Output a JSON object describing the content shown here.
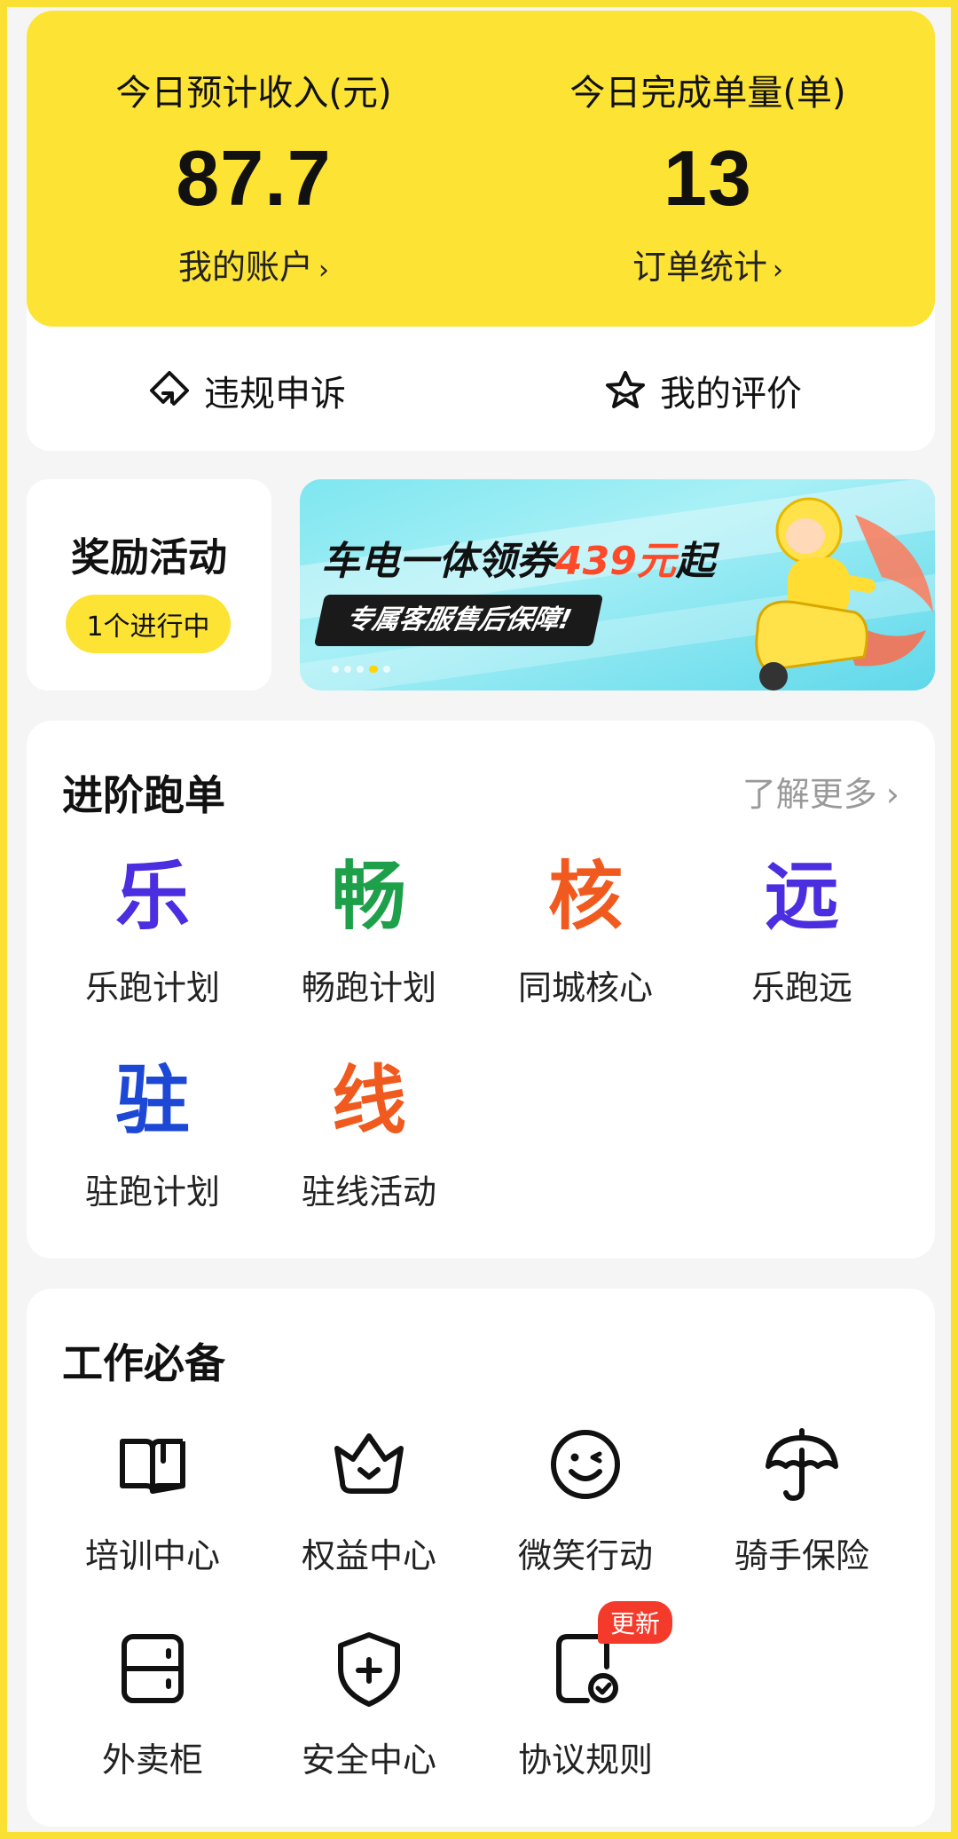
{
  "stats": {
    "income": {
      "label": "今日预计收入(元)",
      "value": "87.7",
      "link": "我的账户"
    },
    "orders": {
      "label": "今日完成单量(单)",
      "value": "13",
      "link": "订单统计"
    },
    "chevron": "›"
  },
  "actions": {
    "appeal": {
      "label": "违规申诉",
      "icon": "diamond-arrow-icon"
    },
    "evaluation": {
      "label": "我的评价",
      "icon": "star-icon"
    }
  },
  "reward": {
    "title": "奖励活动",
    "badge": "1个进行中"
  },
  "banner": {
    "title_prefix": "车电一体领券",
    "title_highlight": "439元",
    "title_suffix": "起",
    "subtitle": "专属客服售后保障!"
  },
  "advanced": {
    "title": "进阶跑单",
    "more": "了解更多",
    "chevron": "›",
    "items": [
      {
        "glyph": "乐",
        "label": "乐跑计划",
        "color": "#4b2ee0"
      },
      {
        "glyph": "畅",
        "label": "畅跑计划",
        "color": "#1ea04a"
      },
      {
        "glyph": "核",
        "label": "同城核心",
        "color": "#f05a1e"
      },
      {
        "glyph": "远",
        "label": "乐跑远",
        "color": "#4b2ee0"
      },
      {
        "glyph": "驻",
        "label": "驻跑计划",
        "color": "#1d48d6"
      },
      {
        "glyph": "线",
        "label": "驻线活动",
        "color": "#f05a1e"
      }
    ]
  },
  "work": {
    "title": "工作必备",
    "items": [
      {
        "label": "培训中心",
        "icon": "book-icon"
      },
      {
        "label": "权益中心",
        "icon": "crown-icon"
      },
      {
        "label": "微笑行动",
        "icon": "smile-icon"
      },
      {
        "label": "骑手保险",
        "icon": "umbrella-icon"
      },
      {
        "label": "外卖柜",
        "icon": "locker-icon"
      },
      {
        "label": "安全中心",
        "icon": "shield-icon"
      },
      {
        "label": "协议规则",
        "icon": "document-check-icon",
        "badge": "更新"
      }
    ]
  },
  "colors": {
    "accent": "#fde334",
    "badge": "#f43b2b"
  }
}
